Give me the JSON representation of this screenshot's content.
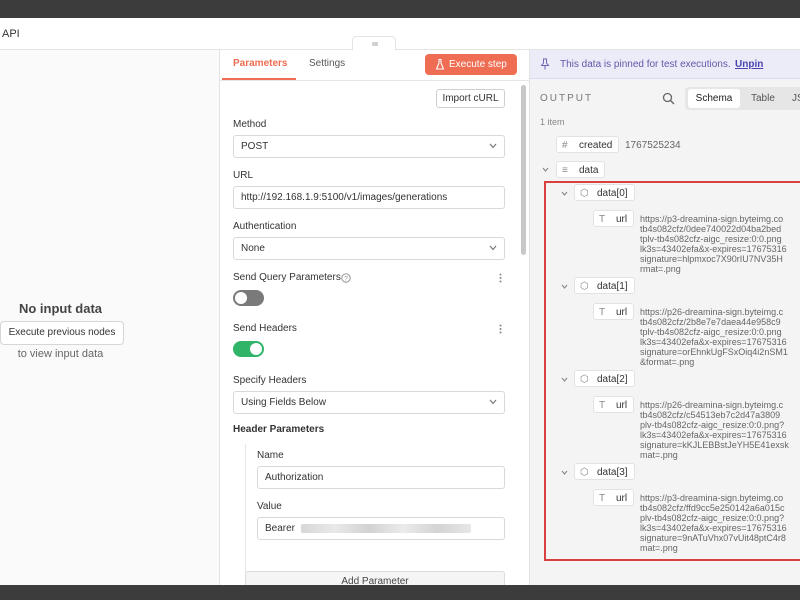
{
  "window": {
    "title": "API"
  },
  "input_panel": {
    "no_data": "No input data",
    "execute_previous": "Execute previous nodes",
    "to_view": "to view input data"
  },
  "params": {
    "tabs": [
      "Parameters",
      "Settings"
    ],
    "execute_step": "Execute step",
    "import_curl": "Import cURL",
    "method_label": "Method",
    "method_value": "POST",
    "url_label": "URL",
    "url_value": "http://192.168.1.9:5100/v1/images/generations",
    "auth_label": "Authentication",
    "auth_value": "None",
    "send_query_label": "Send Query Parameters",
    "send_query_on": false,
    "send_headers_label": "Send Headers",
    "send_headers_on": true,
    "specify_headers_label": "Specify Headers",
    "specify_headers_value": "Using Fields Below",
    "header_params_label": "Header Parameters",
    "name_label": "Name",
    "name_value": "Authorization",
    "value_label": "Value",
    "value_prefix": "Bearer",
    "add_parameter": "Add Parameter"
  },
  "output": {
    "pin_message": "This data is pinned for test executions.",
    "unpin": "Unpin",
    "title": "OUTPUT",
    "view_tabs": [
      "Schema",
      "Table",
      "JS"
    ],
    "item_count": "1 item",
    "created_key": "created",
    "created_value": "1767525234",
    "data_key": "data",
    "items": [
      {
        "key": "data[0]",
        "field": "url",
        "lines": "https://p3-dreamina-sign.byteimg.co\ntb4s082cfz/0dee740022d04ba2bed\ntplv-tb4s082cfz-aigc_resize:0:0.png\nlk3s=43402efa&x-expires=17675316\nsignature=hlpmxoc7X90rIU7NV35H\nrmat=.png"
      },
      {
        "key": "data[1]",
        "field": "url",
        "lines": "https://p26-dreamina-sign.byteimg.c\ntb4s082cfz/2b8e7e7daea44e958c9\ntplv-tb4s082cfz-aigc_resize:0:0.png\nlk3s=43402efa&x-expires=17675316\nsignature=orEhnkUgFSxOiq4i2nSM1\n&format=.png"
      },
      {
        "key": "data[2]",
        "field": "url",
        "lines": "https://p26-dreamina-sign.byteimg.c\ntb4s082cfz/c54513eb7c2d47a3809\nplv-tb4s082cfz-aigc_resize:0:0.png?\nlk3s=43402efa&x-expires=17675316\nsignature=kKJLEBBstJeYH5E41exsk\nmat=.png"
      },
      {
        "key": "data[3]",
        "field": "url",
        "lines": "https://p3-dreamina-sign.byteimg.co\ntb4s082cfz/ffd9cc5e250142a6a015c\nplv-tb4s082cfz-aigc_resize:0:0.png?\nlk3s=43402efa&x-expires=17675316\nsignature=9nATuVhx07vUit48ptC4r8\nmat=.png"
      }
    ]
  },
  "colors": {
    "accent": "#ee6d53",
    "toggle_on": "#2fb468",
    "highlight": "#d94141",
    "pin_text": "#5f5aa8"
  },
  "icons": [
    "arrow-into-icon",
    "flask-icon",
    "chevron-down-icon",
    "help-icon",
    "kebab-icon",
    "pin-icon",
    "search-icon",
    "hash-icon",
    "list-icon",
    "cube-icon",
    "text-type-icon",
    "caret-down-icon"
  ]
}
